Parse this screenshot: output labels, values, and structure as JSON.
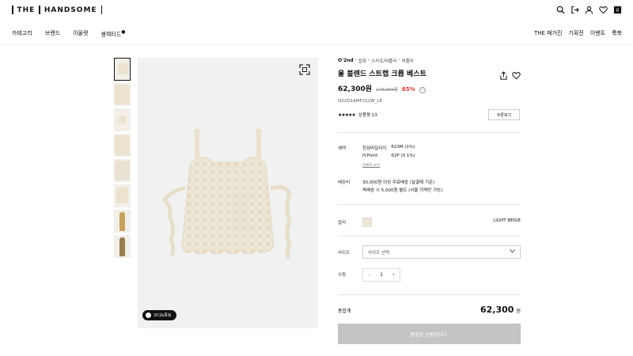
{
  "header": {
    "logo_left": "THE",
    "logo_right": "HANDSOME",
    "icons": [
      "search-icon",
      "login-icon",
      "user-icon",
      "heart-icon",
      "cart-icon"
    ],
    "cart_count": "0",
    "menu_left": [
      "카테고리",
      "브랜드",
      "이올렛",
      "셀렉티드"
    ],
    "menu_right": [
      "THE 매거진",
      "기획전",
      "이벤트",
      "룩북"
    ]
  },
  "gallery": {
    "thumbnail_count": 8,
    "codi_button": "코디&룩북"
  },
  "product": {
    "breadcrumb": [
      "O'2nd",
      "잡화",
      "스카프/머플러",
      "머플러"
    ],
    "title": "울 블렌드 스트랩 크롭 베스트",
    "price": "62,300원",
    "original_price": "178,000원",
    "discount_rate": "65%",
    "code": "O22D1AMF212W_LE",
    "stars": "★★★★★",
    "review_label": "상품평 13",
    "coupon_button": "쿠폰보기"
  },
  "benefits": {
    "label": "혜택",
    "rows": [
      {
        "name": "한섬마일리지",
        "value": "623M (1%)"
      },
      {
        "name": "H.Point",
        "value": "62P (0.1%)"
      }
    ],
    "detail_link": "자세히 보기"
  },
  "shipping": {
    "label": "배송비",
    "line1": "30,000원 이상 무료배송 (실결제 기준)",
    "line2": "퀵배송 시 5,000원 별도 (서울 지역만 가능)"
  },
  "color": {
    "label": "컬러",
    "name": "LIGHT BEIGE",
    "swatch": "#efe7d4"
  },
  "size": {
    "label": "사이즈",
    "placeholder": "사이즈 선택"
  },
  "quantity": {
    "label": "수량",
    "minus": "−",
    "value": "1",
    "plus": "+"
  },
  "total": {
    "label": "총합계",
    "value": "62,300",
    "unit": "원"
  },
  "soldout_button": "품절된 상품입니다."
}
